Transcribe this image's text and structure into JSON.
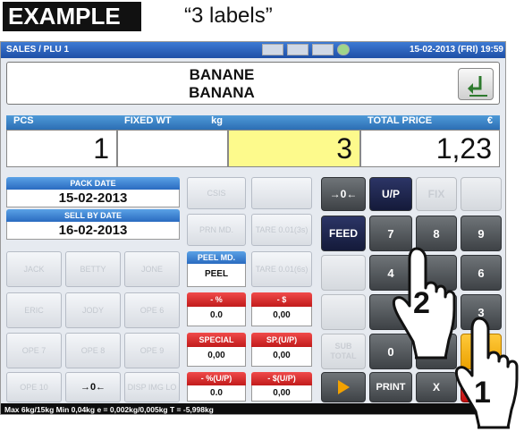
{
  "header": {
    "example": "EXAMPLE",
    "caption": "“3 labels”"
  },
  "topbar": {
    "title": "SALES / PLU 1",
    "datetime": "15-02-2013 (FRI) 19:59"
  },
  "product": {
    "name1": "BANANE",
    "name2": "BANANA"
  },
  "fields": {
    "pcs_label": "PCS",
    "fixed_label": "FIXED WT",
    "fixed_unit": "kg",
    "total_label": "TOTAL PRICE",
    "total_unit": "€",
    "pcs_value": "1",
    "fixed_value": "",
    "qty_value": "3",
    "total_value": "1,23"
  },
  "dates": {
    "pack_label": "PACK DATE",
    "pack_value": "15-02-2013",
    "sell_label": "SELL BY DATE",
    "sell_value": "16-02-2013"
  },
  "buttons": {
    "csis": "CSIS",
    "prn_md": "PRN MD.",
    "tare1": "TARE 0.01(3s)",
    "tare2": "TARE 0.01(6s)",
    "jack": "JACK",
    "betty": "BETTY",
    "jone": "JONE",
    "eric": "ERIC",
    "jody": "JODY",
    "ope6": "OPE 6",
    "ope7": "OPE 7",
    "ope8": "OPE 8",
    "ope9": "OPE 9",
    "ope10": "OPE 10",
    "zero": "→0←",
    "disp_img": "DISP IMG LO",
    "peel_head": "PEEL MD.",
    "peel_val": "PEEL",
    "pct_head": "- %",
    "pct_val": "0.0",
    "dollar_head": "- $",
    "dollar_val": "0,00",
    "special_head": "SPECIAL",
    "special_val": "0,00",
    "sp_head": "SP.(U/P)",
    "sp_val": "0,00",
    "pctup_head": "- %(U/P)",
    "pctup_val": "0.0",
    "dollarup_head": "- $(U/P)",
    "dollarup_val": "0,00",
    "zero_r": "→0←",
    "up": "U/P",
    "fix": "FIX",
    "feed": "FEED",
    "k7": "7",
    "k8": "8",
    "k9": "9",
    "k4": "4",
    "k6": "6",
    "k3": "3",
    "k0": "0",
    "sub_total": "SUB TOTAL",
    "print": "PRINT",
    "x": "X"
  },
  "status": "Max 6kg/15kg  Min 0,04kg  e = 0,002kg/0,005kg  T = -5,998kg",
  "steps": {
    "one": "1",
    "two": "2"
  }
}
